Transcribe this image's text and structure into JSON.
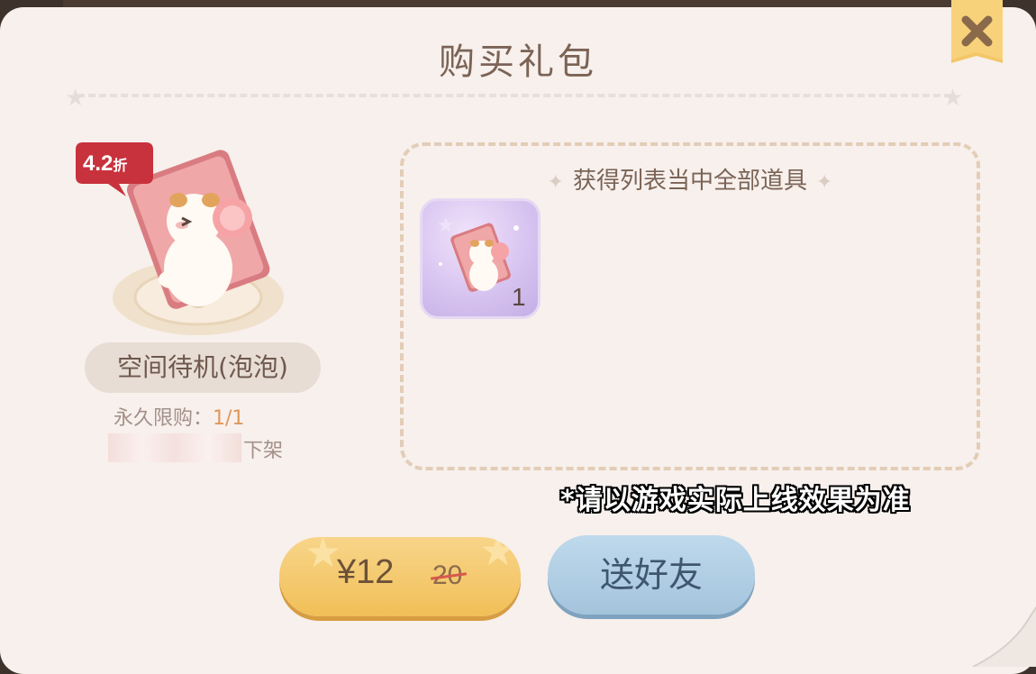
{
  "dialog": {
    "title": "购买礼包",
    "close_icon": "close-x-icon"
  },
  "item": {
    "discount_number": "4.2",
    "discount_suffix": "折",
    "name": "空间待机(泡泡)",
    "limit_label": "永久限购：",
    "limit_value": "1/1",
    "offshelf_suffix": "下架"
  },
  "rewards": {
    "heading": "获得列表当中全部道具",
    "items": [
      {
        "icon": "hamster-bubble-card-icon",
        "count": "1"
      }
    ]
  },
  "notice": "*请以游戏实际上线效果为准",
  "buttons": {
    "buy_price": "¥12",
    "buy_old_price": "20",
    "gift_label": "送好友"
  },
  "colors": {
    "panel": "#f7f0ec",
    "title": "#7b6356",
    "buy_button": "#f1bf57",
    "gift_button": "#a4c4dc",
    "badge": "#c8323d",
    "limit_value": "#e0975b"
  }
}
